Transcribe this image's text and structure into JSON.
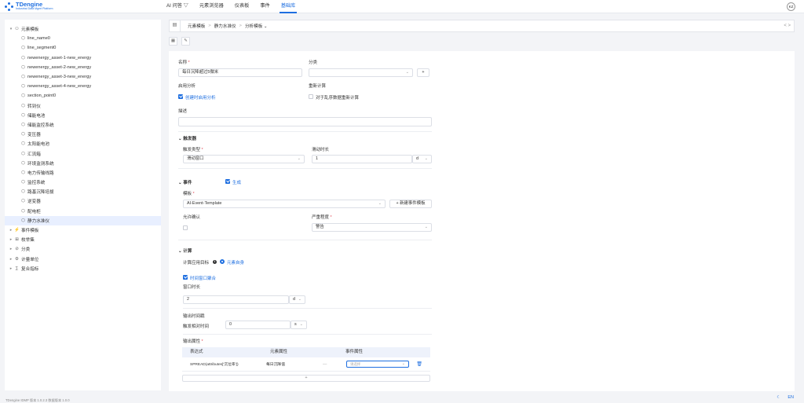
{
  "app": {
    "name": "TDengine",
    "subtitle": "Industrial Data Mgmt Platform"
  },
  "nav": [
    {
      "label": "AI 问答 ▽"
    },
    {
      "label": "元素浏览器"
    },
    {
      "label": "仪表板"
    },
    {
      "label": "事件"
    },
    {
      "label": "基础库"
    }
  ],
  "user": {
    "initials": "KZ"
  },
  "sidebar": {
    "root": "元素模板",
    "children": [
      "line_name0",
      "line_segment0",
      "newenergy_asset-1-new_energy",
      "newenergy_asset-2-new_energy",
      "newenergy_asset-3-new_energy",
      "newenergy_asset-4-new_energy",
      "section_point0",
      "转到仪",
      "储能电池",
      "储能监控系统",
      "变压器",
      "太阳能电池",
      "汇流箱",
      "环境监测系统",
      "电力传输线路",
      "监控系统",
      "路基沉降培拔",
      "逆变器",
      "配电柜",
      "静力水准仪"
    ],
    "groups": [
      "事件模板",
      "枚举集",
      "分类",
      "计量单位",
      "复合指标"
    ]
  },
  "breadcrumb": {
    "items": [
      "元素模板",
      "静力水准仪",
      "分析模板 ⌄"
    ],
    "sep": ">",
    "nav": "< >"
  },
  "form": {
    "name_label": "名称",
    "name_value": "每日沉降超过5微米",
    "category_label": "分类",
    "enable_label": "启用分析",
    "enable_text": "创建时启用分析",
    "recalc_label": "重新计算",
    "recalc_text": "对于乱序数据重新计算",
    "desc_label": "描述",
    "trigger_section": "触发器",
    "trigger_type_label": "触发类型",
    "trigger_type_value": "滑动窗口",
    "slide_label": "滑动时长",
    "slide_value": "1",
    "slide_unit": "d",
    "event_section": "事件",
    "event_generate": "生成",
    "template_label": "模板",
    "template_value": "AI-Event-Template",
    "new_template_btn": "+ 新建事件模板",
    "allow_confirm_label": "允许确认",
    "severity_label": "严重程度",
    "severity_value": "警告",
    "calc_section": "计算",
    "calc_target_label": "计算应用目标",
    "calc_target_value": "元素自身",
    "window_agg_text": "时间窗口聚合",
    "window_len_label": "窗口时长",
    "window_len_value": "2",
    "window_len_unit": "d",
    "output_time_label": "输出时间戳",
    "trigger_offset_label": "触发相对时间",
    "trigger_offset_value": "0",
    "trigger_offset_unit": "s",
    "output_attr_label": "输出属性",
    "table_headers": [
      "表达式",
      "元素属性",
      "事件属性"
    ],
    "table_rows": [
      {
        "expr": "SPREAD(attributes['沉位率'])",
        "elem": "每日沉降值",
        "dash": "—",
        "event_placeholder": "请选择"
      }
    ],
    "add_row": "+"
  },
  "footer": {
    "version": "TDengine IDMP 版本 1.0.2.3 数据版本 1.0.0",
    "lang": "EN"
  }
}
